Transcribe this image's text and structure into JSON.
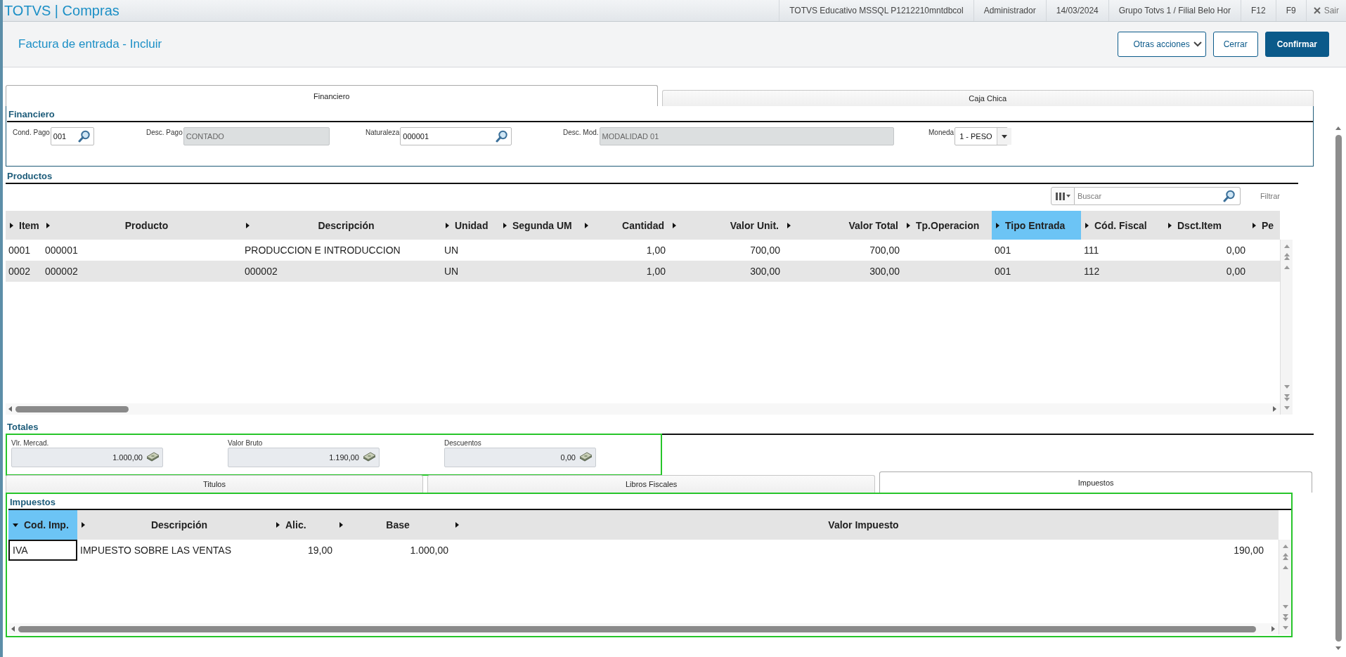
{
  "app": {
    "title": "TOTVS | Compras",
    "info": [
      "TOTVS Educativo MSSQL P1212210mntdbcol",
      "Administrador",
      "14/03/2024",
      "Grupo Totvs 1 / Filial Belo Hor",
      "F12",
      "F9"
    ],
    "exit": "Sair"
  },
  "page": {
    "title": "Factura de entrada - Incluir",
    "buttons": [
      {
        "label": "Otras acciones",
        "kind": "dropdown"
      },
      {
        "label": "Cerrar",
        "kind": "secondary"
      },
      {
        "label": "Confirmar",
        "kind": "primary"
      }
    ]
  },
  "tabs": [
    {
      "label": "Financiero",
      "selected": true
    },
    {
      "label": "Caja Chica",
      "selected": false
    }
  ],
  "financiero": {
    "title": "Financiero",
    "fields": [
      {
        "label": "Cond. Pago",
        "value": "001",
        "kind": "lookup",
        "disabled": false
      },
      {
        "label": "Desc. Pago",
        "value": "CONTADO",
        "kind": "text",
        "disabled": true
      },
      {
        "label": "Naturaleza",
        "value": "000001",
        "kind": "lookup",
        "disabled": false
      },
      {
        "label": "Desc. Mod.",
        "value": "MODALIDAD 01",
        "kind": "text",
        "disabled": true
      },
      {
        "label": "Moneda",
        "value": "1 - PESO",
        "kind": "select",
        "disabled": false
      }
    ]
  },
  "productos": {
    "title": "Productos",
    "search": {
      "placeholder": "Buscar"
    },
    "filter": "Filtrar",
    "columns": [
      {
        "label": "Item",
        "selected": false,
        "sorted": false
      },
      {
        "label": "Producto",
        "selected": false,
        "sorted": false
      },
      {
        "label": "Descripción",
        "selected": false,
        "sorted": false
      },
      {
        "label": "Unidad",
        "selected": false,
        "sorted": false
      },
      {
        "label": "Segunda UM",
        "selected": false,
        "sorted": false
      },
      {
        "label": "Cantidad",
        "selected": false,
        "sorted": false
      },
      {
        "label": "Valor Unit.",
        "selected": false,
        "sorted": false
      },
      {
        "label": "Valor Total",
        "selected": false,
        "sorted": false
      },
      {
        "label": "Tp.Operacion",
        "selected": false,
        "sorted": false
      },
      {
        "label": "Tipo Entrada",
        "selected": true,
        "sorted": false
      },
      {
        "label": "Cód. Fiscal",
        "selected": false,
        "sorted": false
      },
      {
        "label": "Dsct.Item",
        "selected": false,
        "sorted": false
      },
      {
        "label": "Pe",
        "selected": false,
        "sorted": false
      }
    ],
    "rows": [
      {
        "cells": [
          "0001",
          "000001",
          "PRODUCCION E INTRODUCCION",
          "UN",
          "",
          "1,00",
          "700,00",
          "700,00",
          "",
          "001",
          "111",
          "0,00"
        ]
      },
      {
        "cells": [
          "0002",
          "000002",
          "000002",
          "UN",
          "",
          "1,00",
          "300,00",
          "300,00",
          "",
          "001",
          "112",
          "0,00"
        ]
      }
    ]
  },
  "totales": {
    "title": "Totales",
    "fields": [
      {
        "label": "Vlr. Mercad.",
        "value": "1.000,00"
      },
      {
        "label": "Valor Bruto",
        "value": "1.190,00"
      },
      {
        "label": "Descuentos",
        "value": "0,00"
      }
    ]
  },
  "subtabs": [
    {
      "label": "Titulos",
      "selected": false
    },
    {
      "label": "Libros Fiscales",
      "selected": false
    },
    {
      "label": "Impuestos",
      "selected": true
    }
  ],
  "impuestos": {
    "title": "Impuestos",
    "columns": [
      {
        "label": "Cod. Imp.",
        "selected": true,
        "sorted": true
      },
      {
        "label": "Descripción",
        "selected": false,
        "sorted": false
      },
      {
        "label": "Alic.",
        "selected": false,
        "sorted": false
      },
      {
        "label": "Base",
        "selected": false,
        "sorted": false
      },
      {
        "label": "Valor Impuesto",
        "selected": false,
        "sorted": false
      }
    ],
    "rows": [
      {
        "cells": [
          {
            "text": "IVA",
            "focused": true
          },
          {
            "text": "IMPUESTO SOBRE LAS VENTAS",
            "focused": false
          },
          {
            "text": "19,00",
            "focused": false
          },
          {
            "text": "1.000,00",
            "focused": false
          },
          {
            "text": "190,00",
            "focused": false
          }
        ]
      }
    ]
  }
}
